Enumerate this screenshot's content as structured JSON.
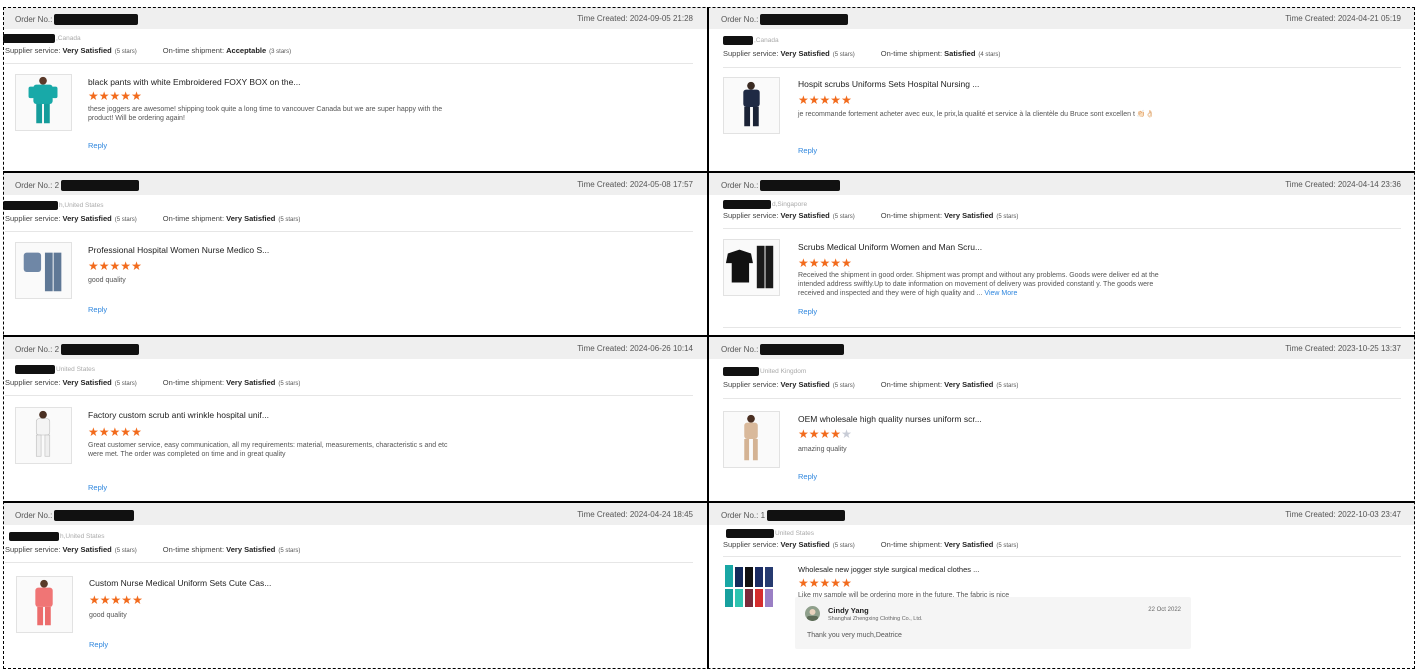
{
  "reviews": [
    {
      "order_label": "Order No.:",
      "time_label": "Time Created:",
      "time": "2024-09-05 21:28",
      "buyer": ",Canada",
      "supplier_label": "Supplier service:",
      "supplier_value": "Very Satisfied",
      "supplier_stars": "(5 stars)",
      "shipment_label": "On-time shipment:",
      "shipment_value": "Acceptable",
      "shipment_stars": "(3 stars)",
      "product_title": "black pants with white Embroidered FOXY BOX on the...",
      "rating": 5,
      "comment": "these joggers are awesome! shipping took quite a long time to vancouver Canada but we are super happy with the product! Will be ordering again!",
      "reply_label": "Reply",
      "thumb": "teal-scrubs"
    },
    {
      "order_label": "Order No.:",
      "time_label": "Time Created:",
      "time": "2024-04-21 05:19",
      "buyer": ",Canada",
      "supplier_label": "Supplier service:",
      "supplier_value": "Very Satisfied",
      "supplier_stars": "(5 stars)",
      "shipment_label": "On-time shipment:",
      "shipment_value": "Satisfied",
      "shipment_stars": "(4 stars)",
      "product_title": "Hospit scrubs Uniforms Sets Hospital Nursing ...",
      "rating": 5,
      "comment": "je recommande fortement acheter avec eux, le prix,la qualité et service à la clientèle du Bruce sont excellen t 👏🏻👌🏻",
      "reply_label": "Reply",
      "thumb": "navy-scrubs"
    },
    {
      "order_label": "Order No.: 2",
      "time_label": "Time Created:",
      "time": "2024-05-08 17:57",
      "buyer": "h,United States",
      "supplier_label": "Supplier service:",
      "supplier_value": "Very Satisfied",
      "supplier_stars": "(5 stars)",
      "shipment_label": "On-time shipment:",
      "shipment_value": "Very Satisfied",
      "shipment_stars": "(5 stars)",
      "product_title": "Professional Hospital Women Nurse Medico S...",
      "rating": 5,
      "comment": "good quality",
      "reply_label": "Reply",
      "thumb": "slate-set"
    },
    {
      "order_label": "Order No.:",
      "time_label": "Time Created:",
      "time": "2024-04-14 23:36",
      "buyer": "d,Singapore",
      "supplier_label": "Supplier service:",
      "supplier_value": "Very Satisfied",
      "supplier_stars": "(5 stars)",
      "shipment_label": "On-time shipment:",
      "shipment_value": "Very Satisfied",
      "shipment_stars": "(5 stars)",
      "product_title": "Scrubs Medical Uniform Women and Man Scru...",
      "rating": 5,
      "comment": "Received the shipment in good order. Shipment was prompt and without any problems. Goods were deliver ed at the intended address swiftly.Up to date information on movement of delivery was provided constantl y. The goods were received and inspected and they were of high quality and ...",
      "view_more": "View More",
      "reply_label": "Reply",
      "thumb": "black-set"
    },
    {
      "order_label": "Order No.: 2",
      "time_label": "Time Created:",
      "time": "2024-06-26 10:14",
      "buyer": "United States",
      "supplier_label": "Supplier service:",
      "supplier_value": "Very Satisfied",
      "supplier_stars": "(5 stars)",
      "shipment_label": "On-time shipment:",
      "shipment_value": "Very Satisfied",
      "shipment_stars": "(5 stars)",
      "product_title": "Factory custom scrub anti wrinkle hospital unif...",
      "rating": 5,
      "comment": "Great customer service, easy communication, all my requirements: material, measurements, characteristic s and etc were met. The order was completed on time and in great quality",
      "reply_label": "Reply",
      "thumb": "white-scrubs"
    },
    {
      "order_label": "Order No.:",
      "time_label": "Time Created:",
      "time": "2023-10-25 13:37",
      "buyer": "United Kingdom",
      "supplier_label": "Supplier service:",
      "supplier_value": "Very Satisfied",
      "supplier_stars": "(5 stars)",
      "shipment_label": "On-time shipment:",
      "shipment_value": "Very Satisfied",
      "shipment_stars": "(5 stars)",
      "product_title": "OEM wholesale high quality nurses uniform scr...",
      "rating": 4,
      "comment": "amazing quality",
      "reply_label": "Reply",
      "thumb": "beige-scrubs"
    },
    {
      "order_label": "Order No.:",
      "time_label": "Time Created:",
      "time": "2024-04-24 18:45",
      "buyer": "h,United States",
      "supplier_label": "Supplier service:",
      "supplier_value": "Very Satisfied",
      "supplier_stars": "(5 stars)",
      "shipment_label": "On-time shipment:",
      "shipment_value": "Very Satisfied",
      "shipment_stars": "(5 stars)",
      "product_title": "Custom Nurse Medical Uniform Sets Cute Cas...",
      "rating": 5,
      "comment": "good quality",
      "reply_label": "Reply",
      "thumb": "pink-scrubs"
    },
    {
      "order_label": "Order No.: 1",
      "time_label": "Time Created:",
      "time": "2022-10-03 23:47",
      "buyer": "United States",
      "supplier_label": "Supplier service:",
      "supplier_value": "Very Satisfied",
      "supplier_stars": "(5 stars)",
      "shipment_label": "On-time shipment:",
      "shipment_value": "Very Satisfied",
      "shipment_stars": "(5 stars)",
      "product_title": "Wholesale new jogger style surgical medical clothes ...",
      "rating": 5,
      "comment": "Like my sample will be ordering more in the future.  The fabric is nice",
      "thumb": "multi-color-scrubs",
      "supplier_reply": {
        "name": "Cindy Yang",
        "company": "Shanghai Zhengxing Clothing Co., Ltd.",
        "date": "22 Oct 2022",
        "message": "Thank you very much,Deatrice"
      }
    }
  ],
  "colors": {
    "star": "#f26b1d",
    "star_off": "#c8ccd6",
    "link": "#2e86de",
    "header_bg": "#efefef"
  }
}
